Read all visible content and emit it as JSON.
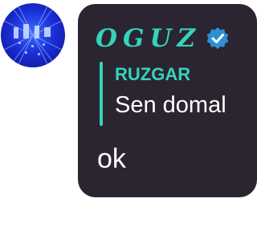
{
  "avatar": {
    "icon": "user-avatar-icon"
  },
  "message": {
    "sender": "OGUZ",
    "verified_icon": "verified-badge-icon",
    "reply": {
      "name": "RUZGAR",
      "text": "Sen domal"
    },
    "text": "ok"
  },
  "colors": {
    "bubble": "#2a2530",
    "accent": "#35d3bc",
    "verified": "#2e8fd6",
    "text": "#ffffff"
  }
}
